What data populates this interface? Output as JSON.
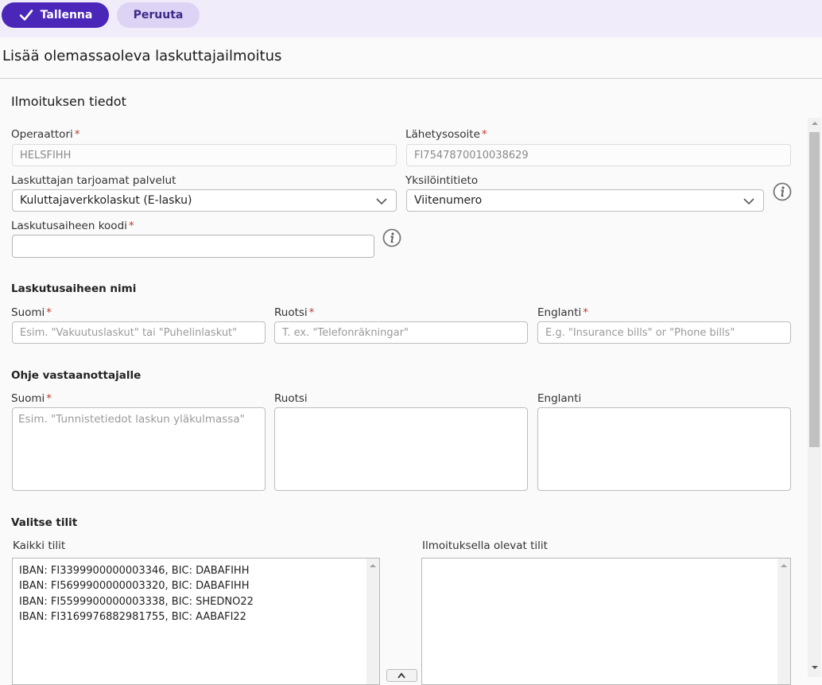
{
  "toolbar": {
    "save_label": "Tallenna",
    "cancel_label": "Peruuta"
  },
  "page_title": "Lisää olemassaoleva laskuttajailmoitus",
  "section_title": "Ilmoituksen tiedot",
  "fields": {
    "operator": {
      "label": "Operaattori",
      "required_mark": "*",
      "value": "HELSFIHH"
    },
    "send_address": {
      "label": "Lähetysosoite",
      "required_mark": "*",
      "value": "FI7547870010038629"
    },
    "services": {
      "label": "Laskuttajan tarjoamat palvelut",
      "value": "Kuluttajaverkkolaskut (E-lasku)"
    },
    "identifier": {
      "label": "Yksilöintitieto",
      "value": "Viitenumero"
    },
    "topic_code": {
      "label": "Laskutusaiheen koodi",
      "required_mark": "*",
      "value": ""
    }
  },
  "topic_name": {
    "heading": "Laskutusaiheen nimi",
    "fi": {
      "label": "Suomi",
      "required_mark": "*",
      "placeholder": "Esim. \"Vakuutuslaskut\" tai \"Puhelinlaskut\""
    },
    "sv": {
      "label": "Ruotsi",
      "required_mark": "*",
      "placeholder": "T. ex. \"Telefonräkningar\""
    },
    "en": {
      "label": "Englanti",
      "required_mark": "*",
      "placeholder": "E.g. \"Insurance bills\" or \"Phone bills\""
    }
  },
  "instructions": {
    "heading": "Ohje vastaanottajalle",
    "fi": {
      "label": "Suomi",
      "required_mark": "*",
      "placeholder": "Esim. \"Tunnistetiedot laskun yläkulmassa\""
    },
    "sv": {
      "label": "Ruotsi"
    },
    "en": {
      "label": "Englanti"
    }
  },
  "accounts": {
    "heading": "Valitse tilit",
    "all_label": "Kaikki tilit",
    "selected_label": "Ilmoituksella olevat tilit",
    "all": [
      "IBAN: FI3399900000003346, BIC: DABAFIHH",
      "IBAN: FI5699900000003320, BIC: DABAFIHH",
      "IBAN: FI5599900000003338, BIC: SHEDNO22",
      "IBAN: FI3169976882981755, BIC: AABAFI22"
    ],
    "selected": []
  },
  "colors": {
    "primary": "#4a27b8",
    "secondary": "#ddd3f5",
    "toolbar_bg": "#f1ecfa",
    "required": "#c0392b"
  }
}
